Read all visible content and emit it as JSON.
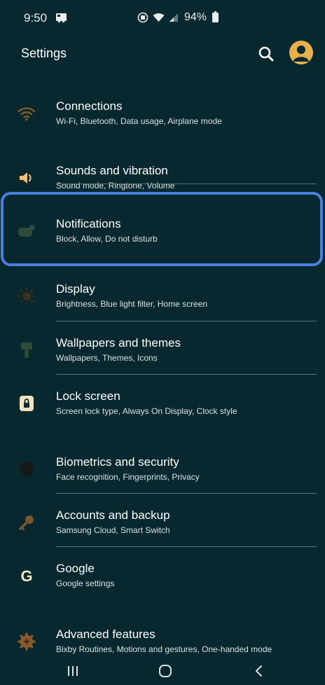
{
  "status_bar": {
    "time": "9:50",
    "battery_percent": "94%"
  },
  "header": {
    "title": "Settings",
    "search_icon": "search-icon",
    "profile_icon": "profile-avatar-icon"
  },
  "colors": {
    "background": "#08282f",
    "accent": "#e7b04a",
    "highlight": "#4a7fe0"
  },
  "items": [
    {
      "title": "Connections",
      "subtitle": "Wi-Fi, Bluetooth, Data usage, Airplane mode",
      "icon": "wifi-icon"
    },
    {
      "title": "Sounds and vibration",
      "subtitle": "Sound mode, Ringtone, Volume",
      "icon": "speaker-icon"
    },
    {
      "title": "Notifications",
      "subtitle": "Block, Allow, Do not disturb",
      "icon": "notification-icon"
    },
    {
      "title": "Display",
      "subtitle": "Brightness, Blue light filter, Home screen",
      "icon": "brightness-icon"
    },
    {
      "title": "Wallpapers and themes",
      "subtitle": "Wallpapers, Themes, Icons",
      "icon": "paintbrush-icon"
    },
    {
      "title": "Lock screen",
      "subtitle": "Screen lock type, Always On Display, Clock style",
      "icon": "lock-icon"
    },
    {
      "title": "Biometrics and security",
      "subtitle": "Face recognition, Fingerprints, Privacy",
      "icon": "shield-icon"
    },
    {
      "title": "Accounts and backup",
      "subtitle": "Samsung Cloud, Smart Switch",
      "icon": "key-icon"
    },
    {
      "title": "Google",
      "subtitle": "Google settings",
      "icon": "google-icon"
    },
    {
      "title": "Advanced features",
      "subtitle": "Bixby Routines, Motions and gestures, One-handed mode",
      "icon": "gear-plus-icon"
    }
  ],
  "nav_bar": {
    "recents": "recents-icon",
    "home": "home-icon",
    "back": "back-icon"
  }
}
